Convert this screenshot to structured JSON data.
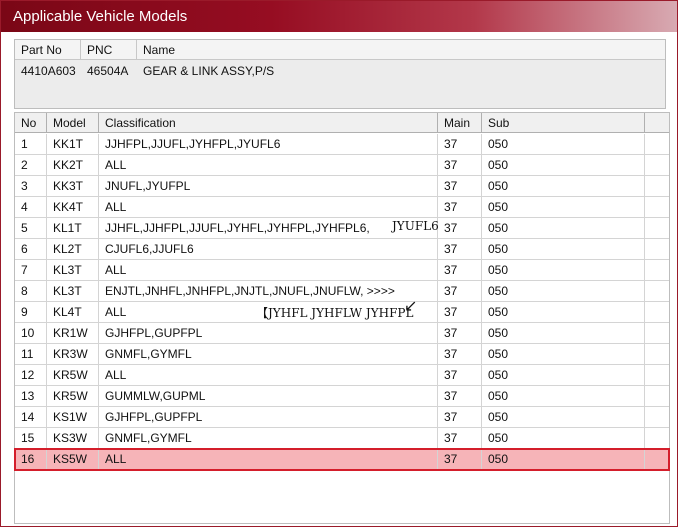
{
  "window": {
    "title": "Applicable Vehicle Models"
  },
  "part": {
    "headers": {
      "part_no": "Part No",
      "pnc": "PNC",
      "name": "Name"
    },
    "values": {
      "part_no": "4410A603",
      "pnc": "46504A",
      "name": "GEAR & LINK ASSY,P/S"
    }
  },
  "grid": {
    "headers": {
      "no": "No",
      "model": "Model",
      "classification": "Classification",
      "main": "Main",
      "sub": "Sub"
    },
    "rows": [
      {
        "no": "1",
        "model": "KK1T",
        "classification": "JJHFPL,JJUFL,JYHFPL,JYUFL6",
        "main": "37",
        "sub": "050"
      },
      {
        "no": "2",
        "model": "KK2T",
        "classification": "ALL",
        "main": "37",
        "sub": "050"
      },
      {
        "no": "3",
        "model": "KK3T",
        "classification": "JNUFL,JYUFPL",
        "main": "37",
        "sub": "050"
      },
      {
        "no": "4",
        "model": "KK4T",
        "classification": "ALL",
        "main": "37",
        "sub": "050"
      },
      {
        "no": "5",
        "model": "KL1T",
        "classification": "JJHFL,JJHFPL,JJUFL,JYHFL,JYHFPL,JYHFPL6,",
        "main": "37",
        "sub": "050"
      },
      {
        "no": "6",
        "model": "KL2T",
        "classification": "CJUFL6,JJUFL6",
        "main": "37",
        "sub": "050"
      },
      {
        "no": "7",
        "model": "KL3T",
        "classification": "ALL",
        "main": "37",
        "sub": "050"
      },
      {
        "no": "8",
        "model": "KL3T",
        "classification": "ENJTL,JNHFL,JNHFPL,JNJTL,JNUFL,JNUFLW,  >>>>",
        "main": "37",
        "sub": "050"
      },
      {
        "no": "9",
        "model": "KL4T",
        "classification": "ALL",
        "main": "37",
        "sub": "050"
      },
      {
        "no": "10",
        "model": "KR1W",
        "classification": "GJHFPL,GUPFPL",
        "main": "37",
        "sub": "050"
      },
      {
        "no": "11",
        "model": "KR3W",
        "classification": "GNMFL,GYMFL",
        "main": "37",
        "sub": "050"
      },
      {
        "no": "12",
        "model": "KR5W",
        "classification": "ALL",
        "main": "37",
        "sub": "050"
      },
      {
        "no": "13",
        "model": "KR5W",
        "classification": "GUMMLW,GUPML",
        "main": "37",
        "sub": "050"
      },
      {
        "no": "14",
        "model": "KS1W",
        "classification": "GJHFPL,GUPFPL",
        "main": "37",
        "sub": "050"
      },
      {
        "no": "15",
        "model": "KS3W",
        "classification": "GNMFL,GYMFL",
        "main": "37",
        "sub": "050"
      },
      {
        "no": "16",
        "model": "KS5W",
        "classification": "ALL",
        "main": "37",
        "sub": "050",
        "selected": true
      }
    ]
  },
  "annotations": {
    "row5_extra": "JYUFL6",
    "row9_note": "【JYHFL JYHFLW JYHFPL",
    "arrow_icon": "arrow-icon"
  },
  "colors": {
    "titlebar": "#960d22",
    "selection_fill": "#f6b4b8",
    "selection_border": "#d41e2b"
  }
}
